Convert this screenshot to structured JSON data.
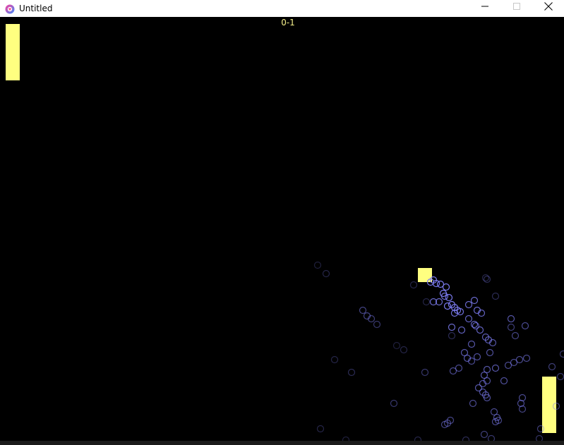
{
  "window": {
    "title": "Untitled",
    "app_icon": "round-logo-icon"
  },
  "controls": {
    "minimize_icon": "minimize-icon",
    "maximize_icon": "maximize-icon",
    "close_icon": "close-icon"
  },
  "game": {
    "score": "0-1",
    "colors": {
      "background": "#000000",
      "paddle": "#ffff80",
      "ball": "#ffff80",
      "score": "#f5f08a",
      "trail": "#7b7bf0"
    }
  }
}
